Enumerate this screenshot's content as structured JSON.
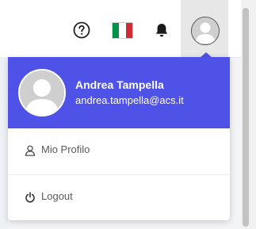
{
  "topbar": {
    "icons": [
      "help-circle-icon",
      "italy-flag-icon",
      "bell-icon",
      "user-avatar-icon"
    ],
    "flag_colors": [
      "#009246",
      "#ffffff",
      "#ce2b37"
    ]
  },
  "profile": {
    "name": "Andrea Tampella",
    "email": "andrea.tampella@acs.it",
    "header_color": "#4f52e6"
  },
  "menu": {
    "items": [
      {
        "label": "Mio Profilo",
        "icon": "user-icon"
      },
      {
        "label": "Logout",
        "icon": "power-icon"
      }
    ]
  }
}
